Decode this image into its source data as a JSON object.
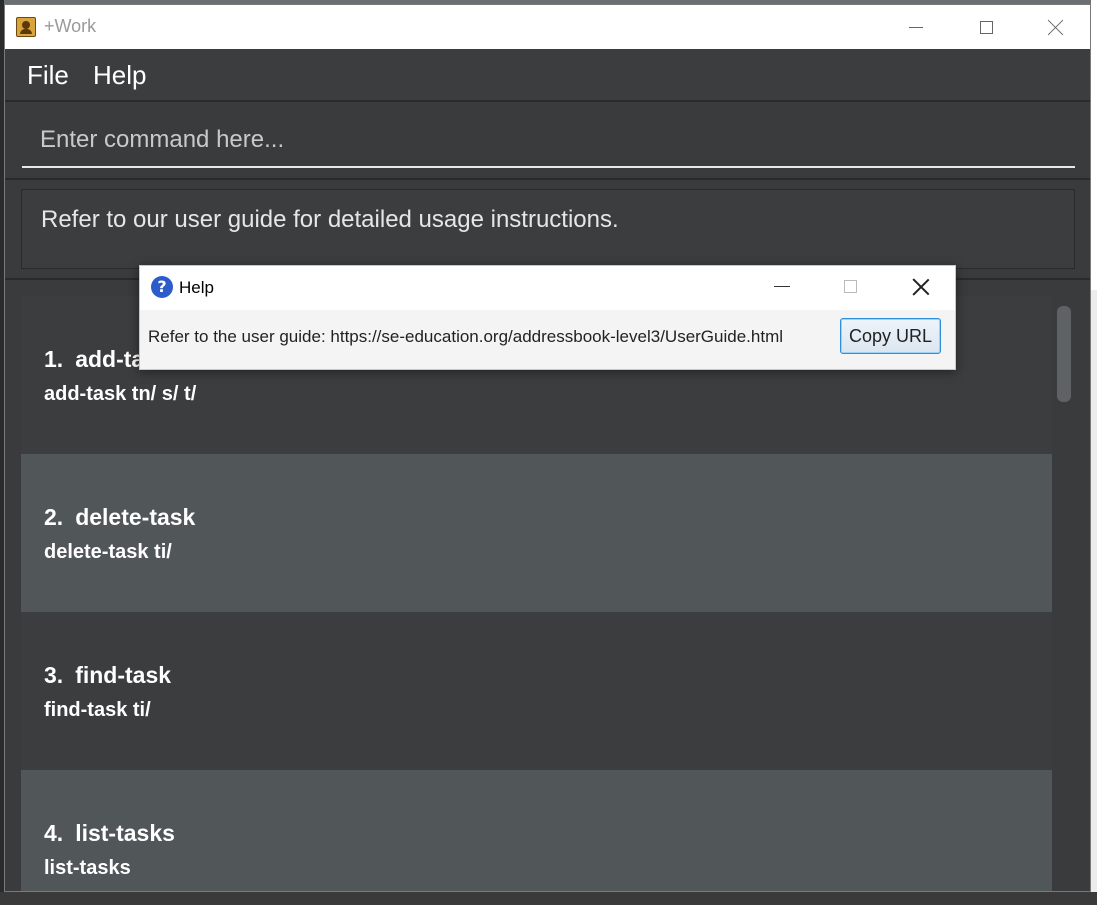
{
  "window": {
    "title": "+Work",
    "icon": "address-book-icon"
  },
  "menu": {
    "file": "File",
    "help": "Help"
  },
  "command": {
    "placeholder": "Enter command here...",
    "value": ""
  },
  "result": {
    "text": "Refer to our user guide for detailed usage instructions."
  },
  "commands": [
    {
      "index": "1.",
      "name": "add-task",
      "usage": "add-task tn/ s/ t/"
    },
    {
      "index": "2.",
      "name": "delete-task",
      "usage": "delete-task ti/"
    },
    {
      "index": "3.",
      "name": "find-task",
      "usage": "find-task ti/"
    },
    {
      "index": "4.",
      "name": "list-tasks",
      "usage": "list-tasks"
    }
  ],
  "help_dialog": {
    "title": "Help",
    "message": "Refer to the user guide: https://se-education.org/addressbook-level3/UserGuide.html",
    "copy_button": "Copy URL",
    "icon": "question-icon",
    "icon_glyph": "?"
  },
  "colors": {
    "background": "#3a3b3d",
    "cell_odd": "#3c3d3f",
    "cell_even": "#515658",
    "accent": "#2f8fd8"
  }
}
